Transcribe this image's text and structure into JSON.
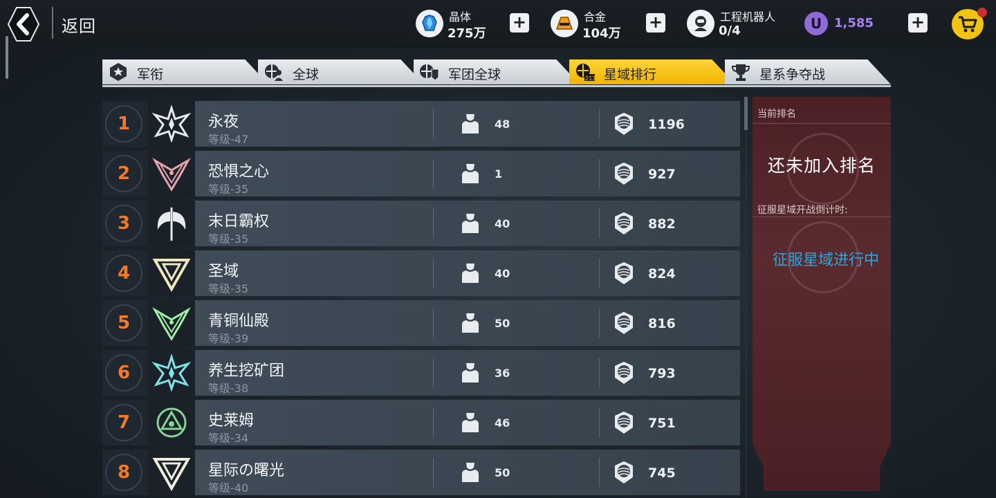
{
  "header": {
    "back_label": "返回",
    "resources": [
      {
        "icon": "crystal-icon",
        "label": "晶体",
        "value": "275万"
      },
      {
        "icon": "alloy-icon",
        "label": "合金",
        "value": "104万"
      },
      {
        "icon": "robot-icon",
        "label": "工程机器人",
        "value": "0/4"
      }
    ],
    "ucoin": {
      "icon": "u-coin-icon",
      "symbol": "U",
      "value": "1,585"
    },
    "shop_icon": "cart-icon"
  },
  "tabs": [
    {
      "label": "军衔",
      "icon": "rank-badge-icon",
      "active": false
    },
    {
      "label": "全球",
      "icon": "globe-person-icon",
      "active": false
    },
    {
      "label": "军团全球",
      "icon": "globe-legion-icon",
      "active": false
    },
    {
      "label": "星域排行",
      "icon": "star-domain-icon",
      "active": true
    },
    {
      "label": "星系争夺战",
      "icon": "trophy-icon",
      "active": false
    }
  ],
  "rankings": [
    {
      "rank": "1",
      "name": "永夜",
      "level": "等级-47",
      "members": "48",
      "points": "1196",
      "emblem_color": "#e8ecef",
      "emblem": "winged-star"
    },
    {
      "rank": "2",
      "name": "恐惧之心",
      "level": "等级-35",
      "members": "1",
      "points": "927",
      "emblem_color": "#e9a3ad",
      "emblem": "crossed-v"
    },
    {
      "rank": "3",
      "name": "末日霸权",
      "level": "等级-35",
      "members": "40",
      "points": "882",
      "emblem_color": "#e8ecef",
      "emblem": "axe"
    },
    {
      "rank": "4",
      "name": "圣域",
      "level": "等级-35",
      "members": "40",
      "points": "824",
      "emblem_color": "#efe7bf",
      "emblem": "triangle"
    },
    {
      "rank": "5",
      "name": "青铜仙殿",
      "level": "等级-39",
      "members": "50",
      "points": "816",
      "emblem_color": "#9ef0a3",
      "emblem": "crossed-v"
    },
    {
      "rank": "6",
      "name": "养生挖矿团",
      "level": "等级-38",
      "members": "36",
      "points": "793",
      "emblem_color": "#7ee4e6",
      "emblem": "winged-star"
    },
    {
      "rank": "7",
      "name": "史莱姆",
      "level": "等级-34",
      "members": "46",
      "points": "751",
      "emblem_color": "#86d493",
      "emblem": "circle-tri"
    },
    {
      "rank": "8",
      "name": "星际の曙光",
      "level": "等级-40",
      "members": "50",
      "points": "745",
      "emblem_color": "#efeedc",
      "emblem": "triangle"
    }
  ],
  "panel": {
    "current_rank_title": "当前排名",
    "current_rank_value": "还未加入排名",
    "countdown_title": "征服星域开战倒计时:",
    "countdown_status": "征服星域进行中"
  }
}
